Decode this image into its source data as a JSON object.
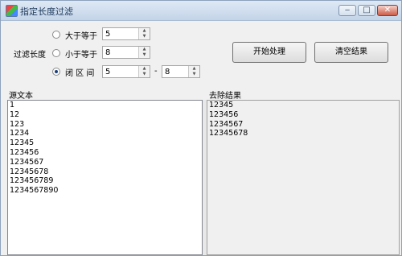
{
  "window": {
    "title": "指定长度过滤",
    "minimize": "‒",
    "maximize": "□",
    "close": "✕"
  },
  "filter": {
    "label": "过滤长度",
    "options": [
      {
        "label": "大于等于",
        "value": "5",
        "selected": false
      },
      {
        "label": "小于等于",
        "value": "8",
        "selected": false
      },
      {
        "label": "闭 区 间",
        "from": "5",
        "to": "8",
        "selected": true
      }
    ],
    "range_sep": "-"
  },
  "buttons": {
    "start": "开始处理",
    "clear": "清空结果"
  },
  "source": {
    "label": "源文本",
    "lines": [
      "1",
      "12",
      "123",
      "1234",
      "12345",
      "123456",
      "1234567",
      "12345678",
      "123456789",
      "1234567890"
    ]
  },
  "result": {
    "label": "去除结果",
    "lines": [
      "12345",
      "123456",
      "1234567",
      "12345678"
    ]
  },
  "spin": {
    "up": "▲",
    "down": "▼"
  }
}
